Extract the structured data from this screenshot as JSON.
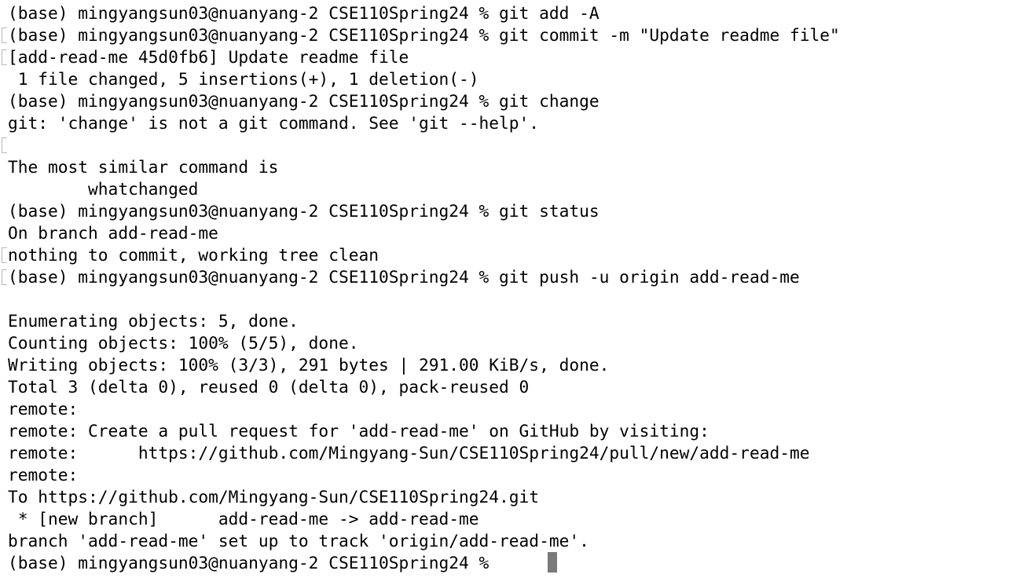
{
  "terminal": {
    "lines": [
      {
        "text": "(base) mingyangsun03@nuanyang-2 CSE110Spring24 % git add -A",
        "mark": false
      },
      {
        "text": "(base) mingyangsun03@nuanyang-2 CSE110Spring24 % git commit -m \"Update readme file\"",
        "mark": true
      },
      {
        "text": "[add-read-me 45d0fb6] Update readme file",
        "mark": true
      },
      {
        "text": " 1 file changed, 5 insertions(+), 1 deletion(-)",
        "mark": false
      },
      {
        "text": "(base) mingyangsun03@nuanyang-2 CSE110Spring24 % git change",
        "mark": false
      },
      {
        "text": "git: 'change' is not a git command. See 'git --help'.",
        "mark": false
      },
      {
        "text": "",
        "mark": true
      },
      {
        "text": "The most similar command is",
        "mark": false
      },
      {
        "text": "        whatchanged",
        "mark": false
      },
      {
        "text": "(base) mingyangsun03@nuanyang-2 CSE110Spring24 % git status",
        "mark": false
      },
      {
        "text": "On branch add-read-me",
        "mark": false
      },
      {
        "text": "nothing to commit, working tree clean",
        "mark": true
      },
      {
        "text": "(base) mingyangsun03@nuanyang-2 CSE110Spring24 % git push -u origin add-read-me",
        "mark": true
      },
      {
        "text": "",
        "mark": false
      },
      {
        "text": "Enumerating objects: 5, done.",
        "mark": false
      },
      {
        "text": "Counting objects: 100% (5/5), done.",
        "mark": false
      },
      {
        "text": "Writing objects: 100% (3/3), 291 bytes | 291.00 KiB/s, done.",
        "mark": false
      },
      {
        "text": "Total 3 (delta 0), reused 0 (delta 0), pack-reused 0",
        "mark": false
      },
      {
        "text": "remote:",
        "mark": false
      },
      {
        "text": "remote: Create a pull request for 'add-read-me' on GitHub by visiting:",
        "mark": false
      },
      {
        "text": "remote:      https://github.com/Mingyang-Sun/CSE110Spring24/pull/new/add-read-me",
        "mark": false
      },
      {
        "text": "remote:",
        "mark": false
      },
      {
        "text": "To https://github.com/Mingyang-Sun/CSE110Spring24.git",
        "mark": false
      },
      {
        "text": " * [new branch]      add-read-me -> add-read-me",
        "mark": false
      },
      {
        "text": "branch 'add-read-me' set up to track 'origin/add-read-me'.",
        "mark": false
      },
      {
        "text": "(base) mingyangsun03@nuanyang-2 CSE110Spring24 % ",
        "mark": false
      }
    ]
  }
}
